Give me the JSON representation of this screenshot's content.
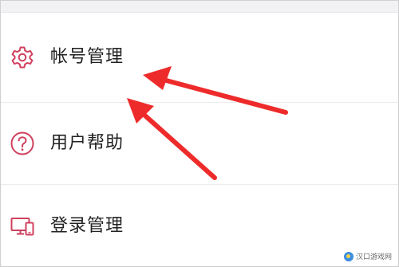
{
  "theme": {
    "icon_color": "#d0405d",
    "arrow_color": "#ee2b2b",
    "text_color": "#222222",
    "divider_color": "#ececef"
  },
  "menu": {
    "items": [
      {
        "label": "帐号管理",
        "icon": "gear-icon"
      },
      {
        "label": "用户帮助",
        "icon": "question-circle-icon"
      },
      {
        "label": "登录管理",
        "icon": "devices-icon"
      }
    ]
  },
  "annotations": {
    "arrows": [
      {
        "points_to": "帐号管理"
      },
      {
        "points_to": "帐号管理"
      }
    ]
  },
  "watermark": {
    "text": "汉口游戏网"
  }
}
